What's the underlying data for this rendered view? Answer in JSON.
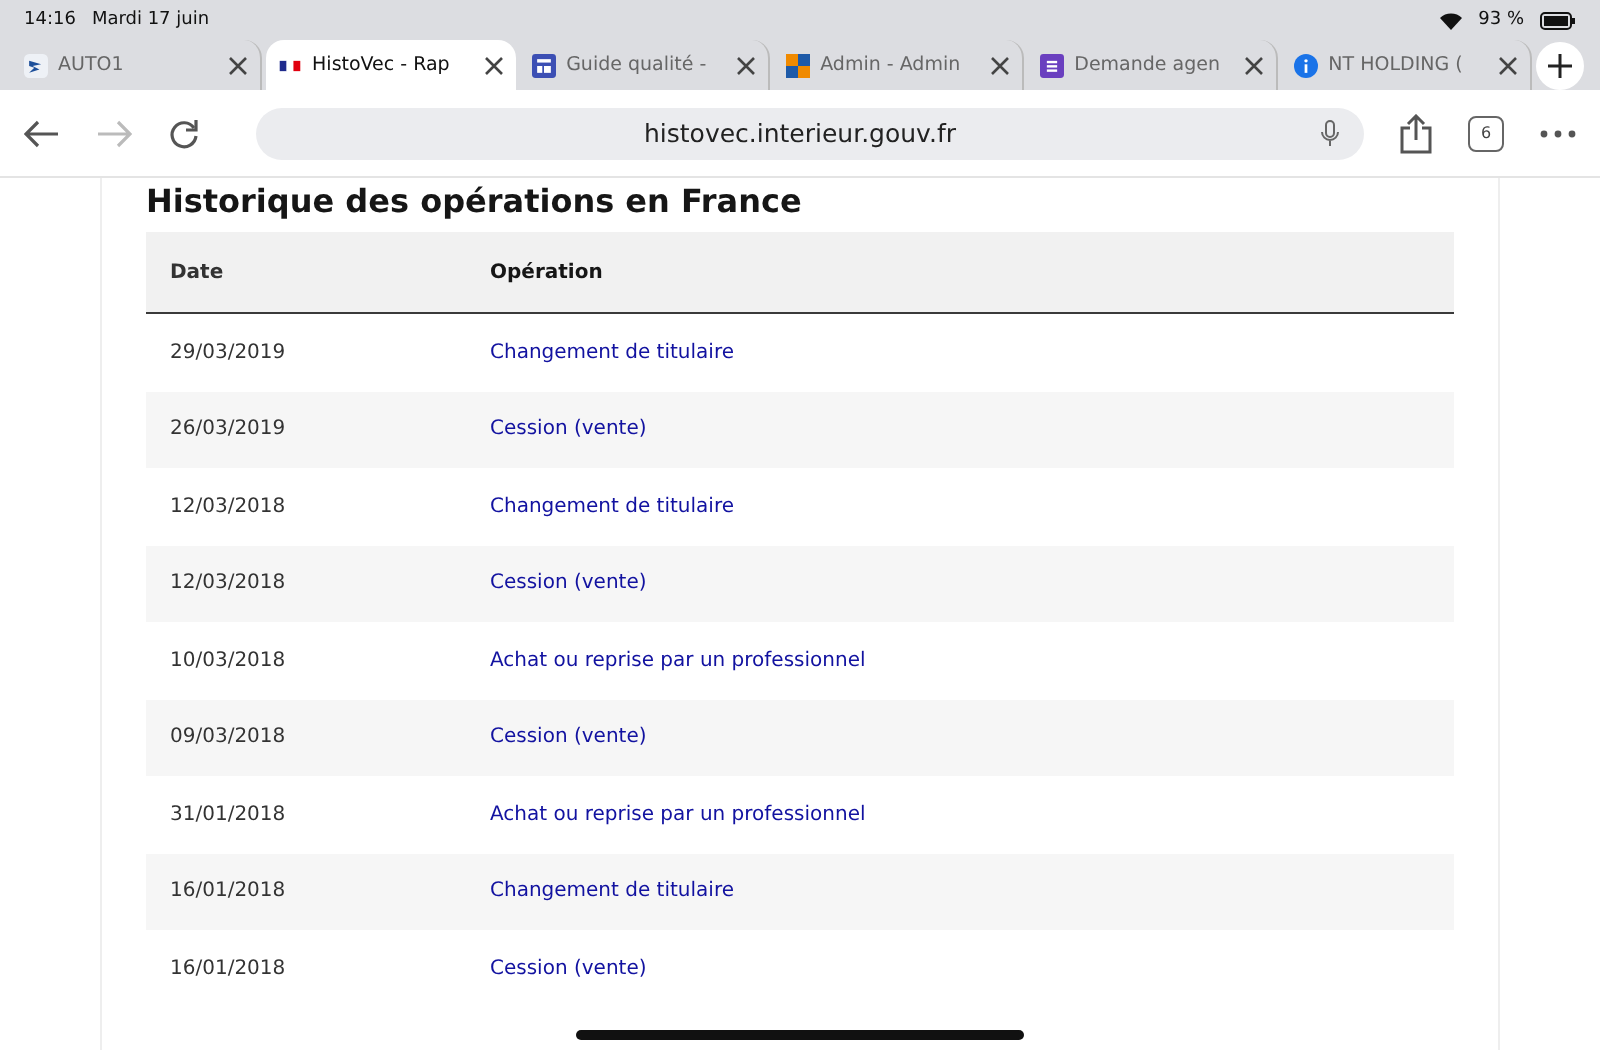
{
  "status_bar": {
    "time": "14:16",
    "date": "Mardi 17 juin",
    "battery": "93 %"
  },
  "tabs": [
    {
      "label": "AUTO1",
      "selected": false
    },
    {
      "label": "HistoVec - Rap",
      "selected": true
    },
    {
      "label": "Guide qualité -",
      "selected": false
    },
    {
      "label": "Admin - Admin",
      "selected": false
    },
    {
      "label": "Demande agen",
      "selected": false
    },
    {
      "label": "NT HOLDING (",
      "selected": false
    }
  ],
  "toolbar": {
    "url": "histovec.interieur.gouv.fr",
    "tab_count": "6"
  },
  "page": {
    "heading": "Historique des opérations en France",
    "table": {
      "columns": [
        "Date",
        "Opération"
      ],
      "rows": [
        {
          "date": "29/03/2019",
          "operation": "Changement de titulaire"
        },
        {
          "date": "26/03/2019",
          "operation": "Cession (vente)"
        },
        {
          "date": "12/03/2018",
          "operation": "Changement de titulaire"
        },
        {
          "date": "12/03/2018",
          "operation": "Cession (vente)"
        },
        {
          "date": "10/03/2018",
          "operation": "Achat ou reprise par un professionnel"
        },
        {
          "date": "09/03/2018",
          "operation": "Cession (vente)"
        },
        {
          "date": "31/01/2018",
          "operation": "Achat ou reprise par un professionnel"
        },
        {
          "date": "16/01/2018",
          "operation": "Changement de titulaire"
        },
        {
          "date": "16/01/2018",
          "operation": "Cession (vente)"
        }
      ]
    }
  }
}
